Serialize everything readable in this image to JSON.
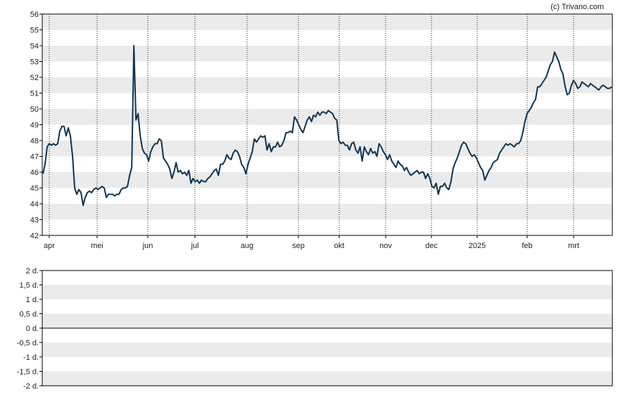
{
  "credit": "(c) Trivano.com",
  "colors": {
    "line": "#0d3450",
    "band": "#ebebeb",
    "grid": "#222222",
    "axis": "#000000"
  },
  "chart_data": [
    {
      "type": "line",
      "ylim": [
        42,
        56
      ],
      "y_ticks": [
        "42",
        "43",
        "44",
        "45",
        "46",
        "47",
        "48",
        "49",
        "50",
        "51",
        "52",
        "53",
        "54",
        "55",
        "56"
      ],
      "x_months": [
        "apr",
        "mei",
        "jun",
        "jul",
        "aug",
        "sep",
        "okt",
        "nov",
        "dec",
        "2025",
        "feb",
        "mrt"
      ],
      "grid": "dotted vertical lines at month starts, alternating horizontal bands",
      "series": [
        {
          "y": [
            45.9,
            46.5,
            47.6,
            47.8,
            47.7,
            47.8,
            47.7,
            47.8,
            48.6,
            48.9,
            48.9,
            48.3,
            48.8,
            48.3,
            47.0,
            45.0,
            44.6,
            44.9,
            44.7,
            43.9,
            44.4,
            44.7,
            44.8,
            44.7,
            44.9,
            45.0,
            44.9,
            45.0,
            45.1,
            45.0,
            44.4,
            44.6,
            44.6,
            44.6,
            44.5,
            44.6,
            44.6,
            44.9,
            45.0,
            45.0,
            45.1,
            45.8,
            46.3,
            54.0,
            49.3,
            49.7,
            48.3,
            47.5,
            47.2,
            47.1,
            46.7,
            47.3,
            47.6,
            47.8,
            47.8,
            48.1,
            48.0,
            46.9,
            46.7,
            46.5,
            46.2,
            45.6,
            46.0,
            46.6,
            46.0,
            46.1,
            45.9,
            46.0,
            45.8,
            46.1,
            45.3,
            45.6,
            45.4,
            45.5,
            45.3,
            45.5,
            45.4,
            45.4,
            45.6,
            45.7,
            45.9,
            46.1,
            46.2,
            45.8,
            46.5,
            46.5,
            46.7,
            47.1,
            46.9,
            46.8,
            47.2,
            47.4,
            47.3,
            47.0,
            46.5,
            46.3,
            45.9,
            46.5,
            46.9,
            47.3,
            48.1,
            47.9,
            48.1,
            48.3,
            48.2,
            48.3,
            47.4,
            47.8,
            47.3,
            47.6,
            47.6,
            47.9,
            47.6,
            47.7,
            48.0,
            48.5,
            48.5,
            48.6,
            48.5,
            49.5,
            49.3,
            49.0,
            48.7,
            48.5,
            48.9,
            49.3,
            49.5,
            49.2,
            49.6,
            49.5,
            49.8,
            49.6,
            49.8,
            49.8,
            49.7,
            49.9,
            49.8,
            49.7,
            49.4,
            49.3,
            48.0,
            47.8,
            47.9,
            47.7,
            47.7,
            47.4,
            47.8,
            47.9,
            47.4,
            47.2,
            47.6,
            46.7,
            47.6,
            47.3,
            47.1,
            47.5,
            47.2,
            47.3,
            47.0,
            47.8,
            47.6,
            47.3,
            47.1,
            46.8,
            47.1,
            46.7,
            46.5,
            46.3,
            46.7,
            46.5,
            46.4,
            46.1,
            46.3,
            46.0,
            45.8,
            45.9,
            46.0,
            46.1,
            45.9,
            46.0,
            46.0,
            45.6,
            45.9,
            45.6,
            45.1,
            45.0,
            45.3,
            44.6,
            45.1,
            45.1,
            45.3,
            45.0,
            44.9,
            45.4,
            46.2,
            46.6,
            46.9,
            47.3,
            47.7,
            47.9,
            47.8,
            47.5,
            47.2,
            47.0,
            47.1,
            46.9,
            46.6,
            46.3,
            46.1,
            45.5,
            45.8,
            46.1,
            46.3,
            46.6,
            46.7,
            46.8,
            47.2,
            47.4,
            47.6,
            47.8,
            47.7,
            47.8,
            47.7,
            47.6,
            47.8,
            47.8,
            48.0,
            48.5,
            49.2,
            49.7,
            49.9,
            50.1,
            50.4,
            50.6,
            51.4,
            51.4,
            51.6,
            51.8,
            52.0,
            52.4,
            52.8,
            53.0,
            53.6,
            53.3,
            53.0,
            52.5,
            52.2,
            51.4,
            50.9,
            51.0,
            51.5,
            51.8,
            51.6,
            51.3,
            51.4,
            51.7,
            51.6,
            51.5,
            51.4,
            51.6,
            51.5,
            51.4,
            51.3,
            51.2,
            51.4,
            51.5,
            51.4,
            51.3,
            51.3,
            51.4
          ]
        }
      ]
    },
    {
      "type": "line",
      "ylim": [
        -2,
        2
      ],
      "y_ticks": [
        "2 d.",
        "1,5 d.",
        "1 d.",
        "0,5 d.",
        "0 d.",
        "-0,5 d.",
        "-1 d.",
        "-1,5 d.",
        "-2 d."
      ],
      "series": []
    }
  ]
}
